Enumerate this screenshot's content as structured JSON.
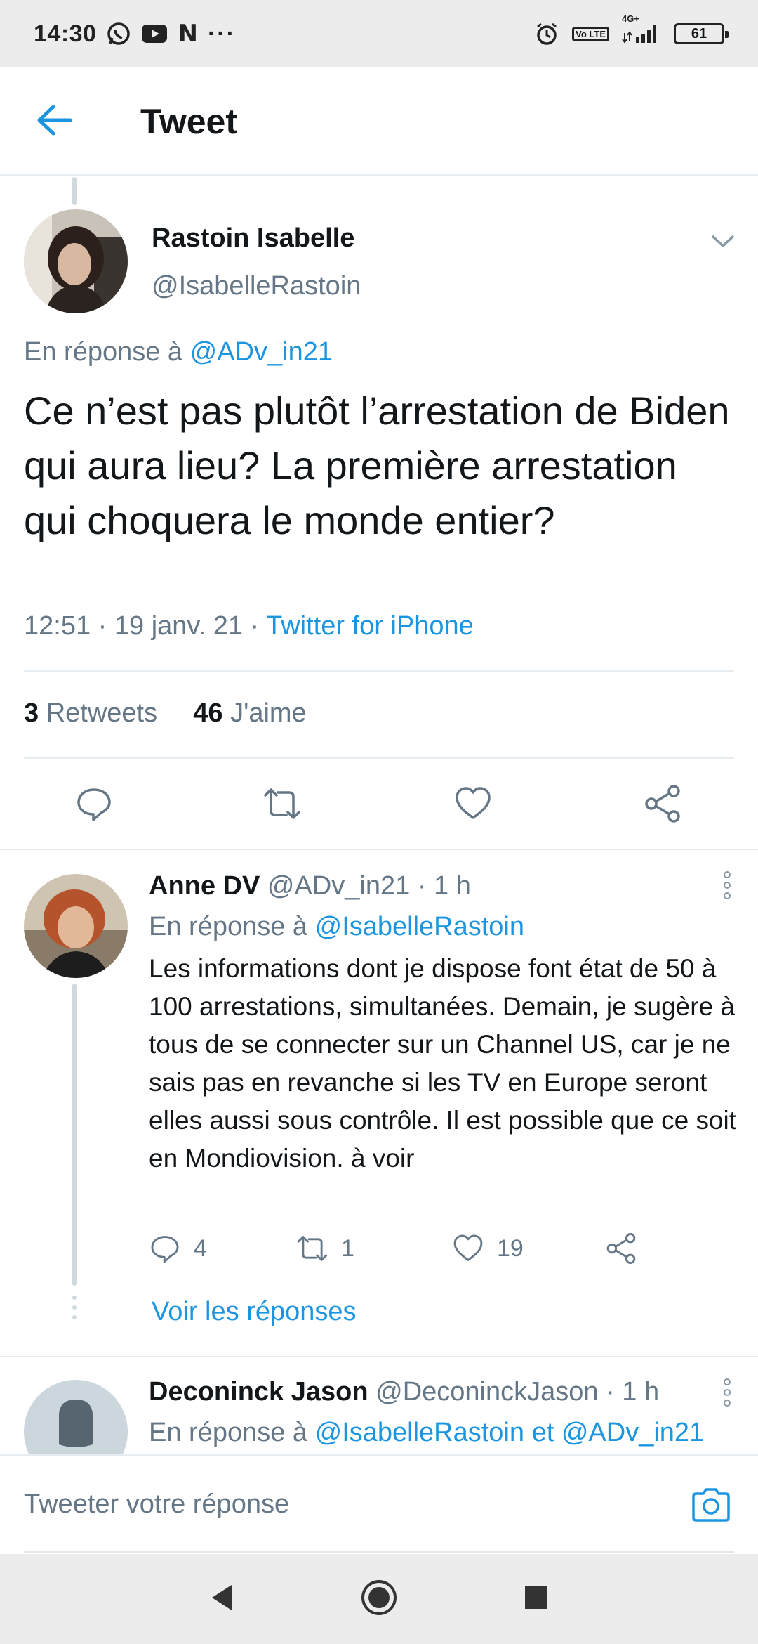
{
  "status_bar": {
    "time": "14:30",
    "left_icons": [
      "whatsapp-icon",
      "youtube-icon",
      "netflix-icon",
      "more-dots-icon"
    ],
    "netflix_letter": "N",
    "more_dots": "···",
    "volte_label": "Vo LTE",
    "network_label": "4G+",
    "battery": "61"
  },
  "app_bar": {
    "title": "Tweet",
    "accent_color": "#1b95e0"
  },
  "main_tweet": {
    "author_name": "Rastoin Isabelle",
    "author_handle": "@IsabelleRastoin",
    "reply_prefix": "En réponse à",
    "reply_to": "@ADv_in21",
    "text": "Ce n’est pas plutôt l’arrestation de Biden qui aura lieu? La première arrestation qui choquera le monde entier?",
    "time": "12:51",
    "date": "19 janv. 21",
    "source": "Twitter for iPhone",
    "retweets_count": "3",
    "retweets_label": "Retweets",
    "likes_count": "46",
    "likes_label": "J'aime"
  },
  "replies": [
    {
      "author_name": "Anne DV",
      "author_handle": "@ADv_in21",
      "age": "· 1 h",
      "reply_prefix": "En réponse à",
      "reply_to": "@IsabelleRastoin",
      "text": "Les informations dont je dispose font état de 50 à 100 arrestations, simultanées. Demain, je sugère à tous de se connecter sur un Channel US, car je ne sais pas en revanche si les TV en Europe seront elles aussi sous contrôle. Il est possible que ce soit en Mondiovision. à voir",
      "comments": "4",
      "retweets": "1",
      "likes": "19",
      "show_replies": "Voir les réponses"
    },
    {
      "author_name": "Deconinck Jason",
      "author_handle": "@DeconinckJason",
      "age": "· 1 h",
      "reply_prefix": "En réponse à",
      "reply_to": "@IsabelleRastoin et @ADv_in21"
    }
  ],
  "composer": {
    "placeholder": "Tweeter votre réponse"
  }
}
